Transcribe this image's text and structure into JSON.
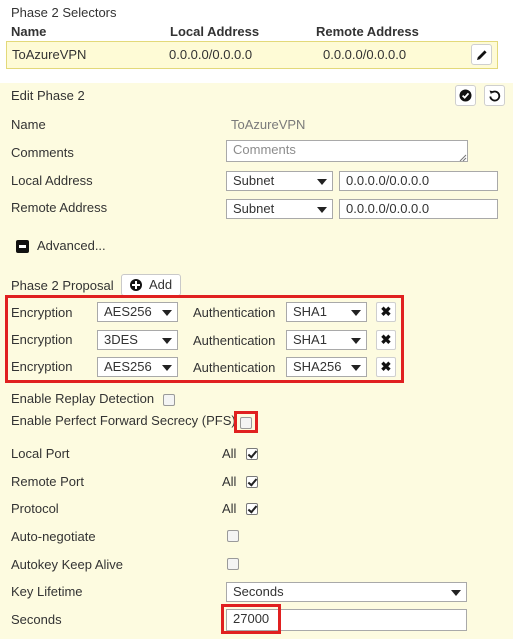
{
  "selectors": {
    "title": "Phase 2 Selectors",
    "headers": {
      "name": "Name",
      "local": "Local Address",
      "remote": "Remote Address"
    },
    "row": {
      "name": "ToAzureVPN",
      "local": "0.0.0.0/0.0.0.0",
      "remote": "0.0.0.0/0.0.0.0"
    }
  },
  "edit": {
    "title": "Edit Phase 2",
    "name_label": "Name",
    "name_value": "ToAzureVPN",
    "comments_label": "Comments",
    "comments_placeholder": "Comments",
    "local_label": "Local Address",
    "local_type": "Subnet",
    "local_value": "0.0.0.0/0.0.0.0",
    "remote_label": "Remote Address",
    "remote_type": "Subnet",
    "remote_value": "0.0.0.0/0.0.0.0",
    "advanced_label": "Advanced..."
  },
  "proposal": {
    "label": "Phase 2 Proposal",
    "add_label": "Add",
    "enc_label": "Encryption",
    "auth_label": "Authentication",
    "rows": [
      {
        "encryption": "AES256",
        "authentication": "SHA1"
      },
      {
        "encryption": "3DES",
        "authentication": "SHA1"
      },
      {
        "encryption": "AES256",
        "authentication": "SHA256"
      }
    ]
  },
  "options": {
    "replay_label": "Enable Replay Detection",
    "replay_checked": false,
    "pfs_label": "Enable Perfect Forward Secrecy (PFS)",
    "pfs_checked": false,
    "local_port_label": "Local Port",
    "local_port_value": "All",
    "remote_port_label": "Remote Port",
    "remote_port_value": "All",
    "protocol_label": "Protocol",
    "protocol_value": "All",
    "autoneg_label": "Auto-negotiate",
    "autoneg_checked": false,
    "keepalive_label": "Autokey Keep Alive",
    "keepalive_checked": false,
    "keylife_label": "Key Lifetime",
    "keylife_value": "Seconds",
    "seconds_label": "Seconds",
    "seconds_value": "27000"
  },
  "colors": {
    "highlight": "#e02020",
    "panel_bg": "#fdfbe0",
    "selected_row_bg": "#fefbd6"
  }
}
